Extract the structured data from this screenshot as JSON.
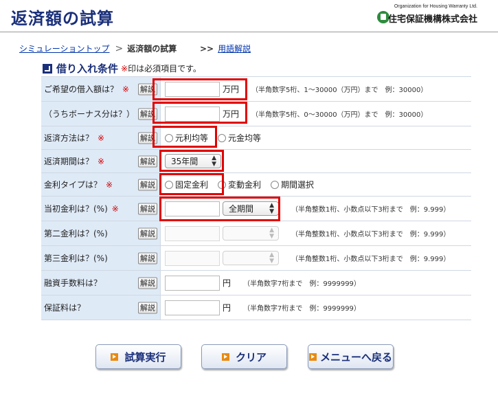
{
  "header": {
    "title": "返済額の試算",
    "org_en": "Organization for Housing Warranty Ltd.",
    "org_name": "住宅保証機構株式会社"
  },
  "breadcrumb": {
    "home": "シミュレーショントップ",
    "separator": ">",
    "current": "返済額の試算",
    "term_prefix": ">>",
    "term_link": "用語解説"
  },
  "section": {
    "title": "借り入れ条件",
    "required_mark": "※",
    "note": "印は必須項目です。"
  },
  "help_label": "解説",
  "rows": [
    {
      "label": "ご希望の借入額は？",
      "required": "※",
      "value": "",
      "unit": "万円",
      "hint": "（半角数字5桁、1〜30000（万円）まで　例：30000）"
    },
    {
      "label": "（うちボーナス分は？）",
      "value": "",
      "unit": "万円",
      "hint": "（半角数字5桁、0〜30000（万円）まで　例：30000）"
    },
    {
      "label": "返済方法は？",
      "required": "※",
      "options": [
        "元利均等",
        "元金均等"
      ]
    },
    {
      "label": "返済期間は？",
      "required": "※",
      "selected": "35年間"
    },
    {
      "label": "金利タイプは？",
      "required": "※",
      "options": [
        "固定金利",
        "変動金利",
        "期間選択"
      ]
    },
    {
      "label": "当初金利は？(%)",
      "required": "※",
      "value": "",
      "selected": "全期間",
      "hint": "（半角整数1桁、小数点以下3桁まで　例：9.999）"
    },
    {
      "label": "第二金利は？(%)",
      "value": "",
      "selected": "",
      "hint": "（半角整数1桁、小数点以下3桁まで　例：9.999）"
    },
    {
      "label": "第三金利は？(%)",
      "value": "",
      "selected": "",
      "hint": "（半角整数1桁、小数点以下3桁まで　例：9.999）"
    },
    {
      "label": "融資手数料は？",
      "value": "",
      "unit": "円",
      "hint": "（半角数字7桁まで　例：9999999）"
    },
    {
      "label": "保証料は？",
      "value": "",
      "unit": "円",
      "hint": "（半角数字7桁まで　例：9999999）"
    }
  ],
  "buttons": {
    "calculate": "試算実行",
    "clear": "クリア",
    "menu": "メニューへ戻る"
  },
  "colors": {
    "title": "#1a2f7a",
    "highlight": "#e10000",
    "label_bg": "#dfeaf7",
    "button_icon": "#e88a10"
  }
}
